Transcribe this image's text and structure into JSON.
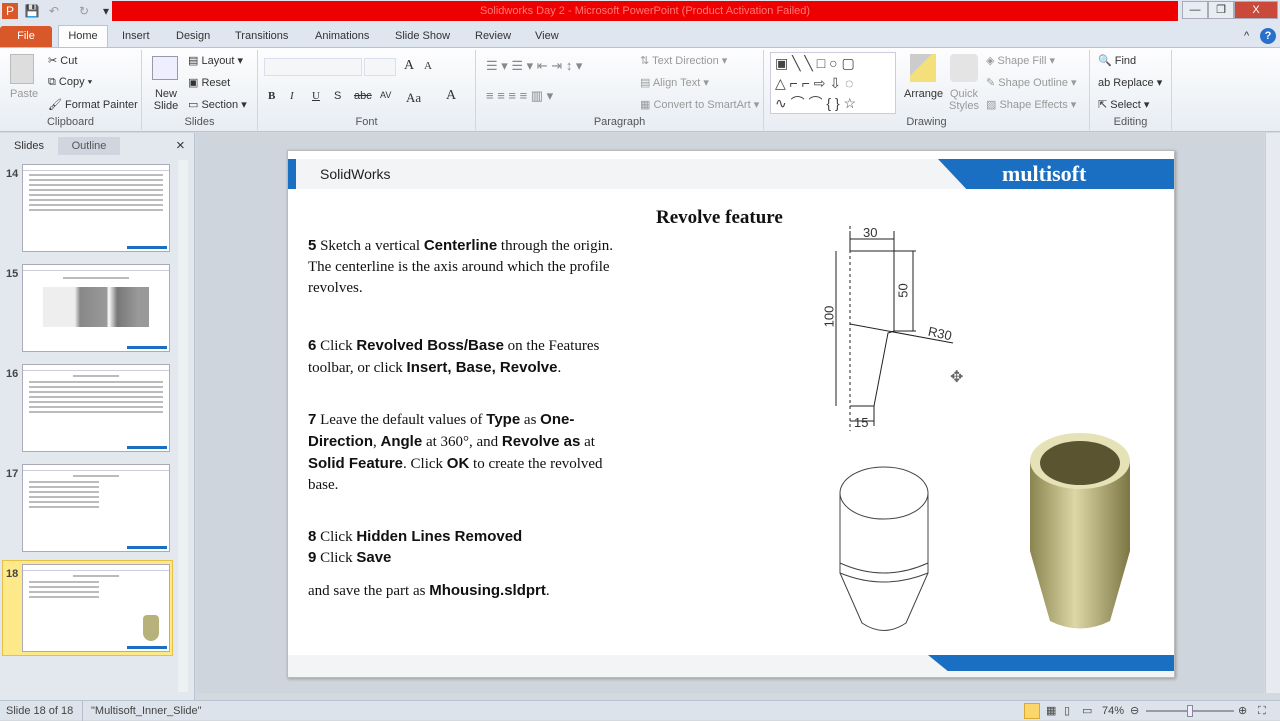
{
  "window": {
    "title": "Solidworks Day 2  -  Microsoft PowerPoint (Product Activation Failed)",
    "minimize": "—",
    "restore": "❐",
    "close": "X"
  },
  "quick_access": {
    "app_icon": "P",
    "save": "💾",
    "undo": "↶",
    "redo": "↻",
    "customize": "▾"
  },
  "tabs": [
    "File",
    "Home",
    "Insert",
    "Design",
    "Transitions",
    "Animations",
    "Slide Show",
    "Review",
    "View"
  ],
  "help": "?",
  "collapse": "^",
  "ribbon": {
    "clipboard": {
      "label": "Clipboard",
      "paste": "Paste",
      "cut": "Cut",
      "copy": "Copy",
      "format_painter": "Format Painter"
    },
    "slides": {
      "label": "Slides",
      "new_slide": "New Slide",
      "layout": "Layout",
      "reset": "Reset",
      "section": "Section"
    },
    "font": {
      "label": "Font",
      "grow": "A",
      "shrink": "A",
      "bold": "B",
      "italic": "I",
      "underline": "U",
      "shadow": "S",
      "strike": "abc",
      "spacing": "AV",
      "case": "Aa",
      "color": "A"
    },
    "paragraph": {
      "label": "Paragraph",
      "text_direction": "Text Direction",
      "align_text": "Align Text",
      "convert_smartart": "Convert to SmartArt"
    },
    "drawing": {
      "label": "Drawing",
      "arrange": "Arrange",
      "quick_styles": "Quick Styles",
      "shape_fill": "Shape Fill",
      "shape_outline": "Shape Outline",
      "shape_effects": "Shape Effects"
    },
    "editing": {
      "label": "Editing",
      "find": "Find",
      "replace": "Replace",
      "select": "Select"
    }
  },
  "panel": {
    "tabs": [
      "Slides",
      "Outline"
    ],
    "close": "×",
    "thumbnails": [
      {
        "num": "14"
      },
      {
        "num": "15"
      },
      {
        "num": "16"
      },
      {
        "num": "17"
      },
      {
        "num": "18"
      }
    ]
  },
  "slide": {
    "header": "SolidWorks",
    "logo": "multisoft",
    "title": "Revolve feature",
    "steps": [
      {
        "n": "5",
        "parts": [
          [
            "Sketch a vertical ",
            0
          ],
          [
            "Centerline",
            1
          ],
          [
            " through the origin.  The centerline is the axis around which the profile revolves.",
            0
          ]
        ]
      },
      {
        "n": "6",
        "parts": [
          [
            "Click ",
            0
          ],
          [
            "Revolved Boss/Base",
            1
          ],
          [
            " on the Features toolbar, or click ",
            0
          ],
          [
            "Insert, Base, Revolve",
            1
          ],
          [
            ".",
            0
          ]
        ]
      },
      {
        "n": "7",
        "parts": [
          [
            "Leave the default values of ",
            0
          ],
          [
            "Type",
            1
          ],
          [
            " as ",
            0
          ],
          [
            "One-Direction",
            1
          ],
          [
            ", ",
            0
          ],
          [
            "Angle",
            1
          ],
          [
            " at 360°, and ",
            0
          ],
          [
            "Revolve as",
            1
          ],
          [
            " at ",
            0
          ],
          [
            "Solid Feature",
            1
          ],
          [
            ". Click ",
            0
          ],
          [
            "OK",
            1
          ],
          [
            " to create the revolved base.",
            0
          ]
        ]
      },
      {
        "n": "8",
        "parts": [
          [
            "Click ",
            0
          ],
          [
            "Hidden Lines Removed",
            1
          ]
        ]
      },
      {
        "n": "9",
        "parts": [
          [
            "Click ",
            0
          ],
          [
            "Save",
            1
          ]
        ]
      }
    ],
    "closing": [
      [
        "and save the part as ",
        0
      ],
      [
        "Mhousing.sldprt",
        1
      ],
      [
        ".",
        0
      ]
    ],
    "dims": {
      "top": "30",
      "right": "50",
      "left": "100",
      "radius": "R30",
      "bottom": "15"
    }
  },
  "status": {
    "slide": "Slide 18 of 18",
    "theme": "\"Multisoft_Inner_Slide\"",
    "zoom": "74%",
    "zoom_fraction": 0.5
  },
  "colors": {
    "accent": "#1a6fc2",
    "title_bar": "#e00000",
    "file_tab": "#d9582a"
  }
}
